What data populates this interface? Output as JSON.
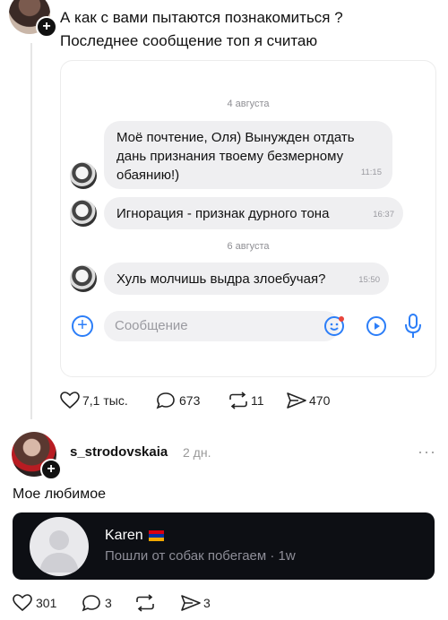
{
  "post1": {
    "text_line1": "А как с вами пытаются познакомиться ?",
    "text_line2": "Последнее сообщение топ я считаю",
    "screenshot": {
      "date1": "4 августа",
      "msg1_line1": "Моё почтение, Оля) Вынужден отдать",
      "msg1_line2": "дань признания твоему безмерному",
      "msg1_line3": "обаянию!)",
      "msg1_time": "11:15",
      "msg2": "Игнорация - признак дурного тона",
      "msg2_time": "16:37",
      "date2": "6 августа",
      "msg3": "Хуль молчишь выдра злоебучая?",
      "msg3_time": "15:50",
      "input_placeholder": "Сообщение"
    },
    "stats": {
      "likes": "7,1 тыс.",
      "comments": "673",
      "reposts": "11",
      "shares": "470"
    }
  },
  "post2": {
    "username": "s_strodovskaia",
    "age": "2 дн.",
    "more": "···",
    "text": "Мое любимое",
    "card": {
      "name": "Karen",
      "message": "Пошли от собак побегаем · 1w"
    },
    "stats": {
      "likes": "301",
      "comments": "3",
      "shares": "3"
    }
  },
  "colors": {
    "accent": "#2c7ef8",
    "dark_card": "#0d0f14"
  }
}
